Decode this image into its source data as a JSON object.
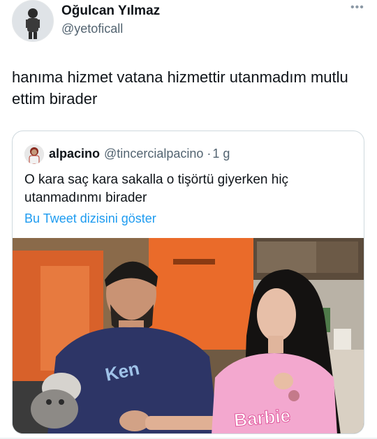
{
  "tweet": {
    "author_name": "Oğulcan Yılmaz",
    "author_handle": "@yetoficall",
    "more_icon": "more-horizontal-icon",
    "text": "hanıma hizmet vatana hizmettir utanmadım mutlu ettim birader"
  },
  "quoted_tweet": {
    "author_name": "alpacino",
    "author_handle": "@tincercialpacino",
    "separator": "·",
    "time": "1 g",
    "text": "O kara saç kara sakalla o tişörtü giyerken hiç utanmadınmı birader",
    "thread_link": "Bu Tweet dizisini göster",
    "media": {
      "left_shirt_text": "Ken",
      "right_shirt_text": "Barbie"
    }
  },
  "colors": {
    "link": "#1d9bf0",
    "secondary_text": "#536471",
    "border": "#cfd9de"
  }
}
